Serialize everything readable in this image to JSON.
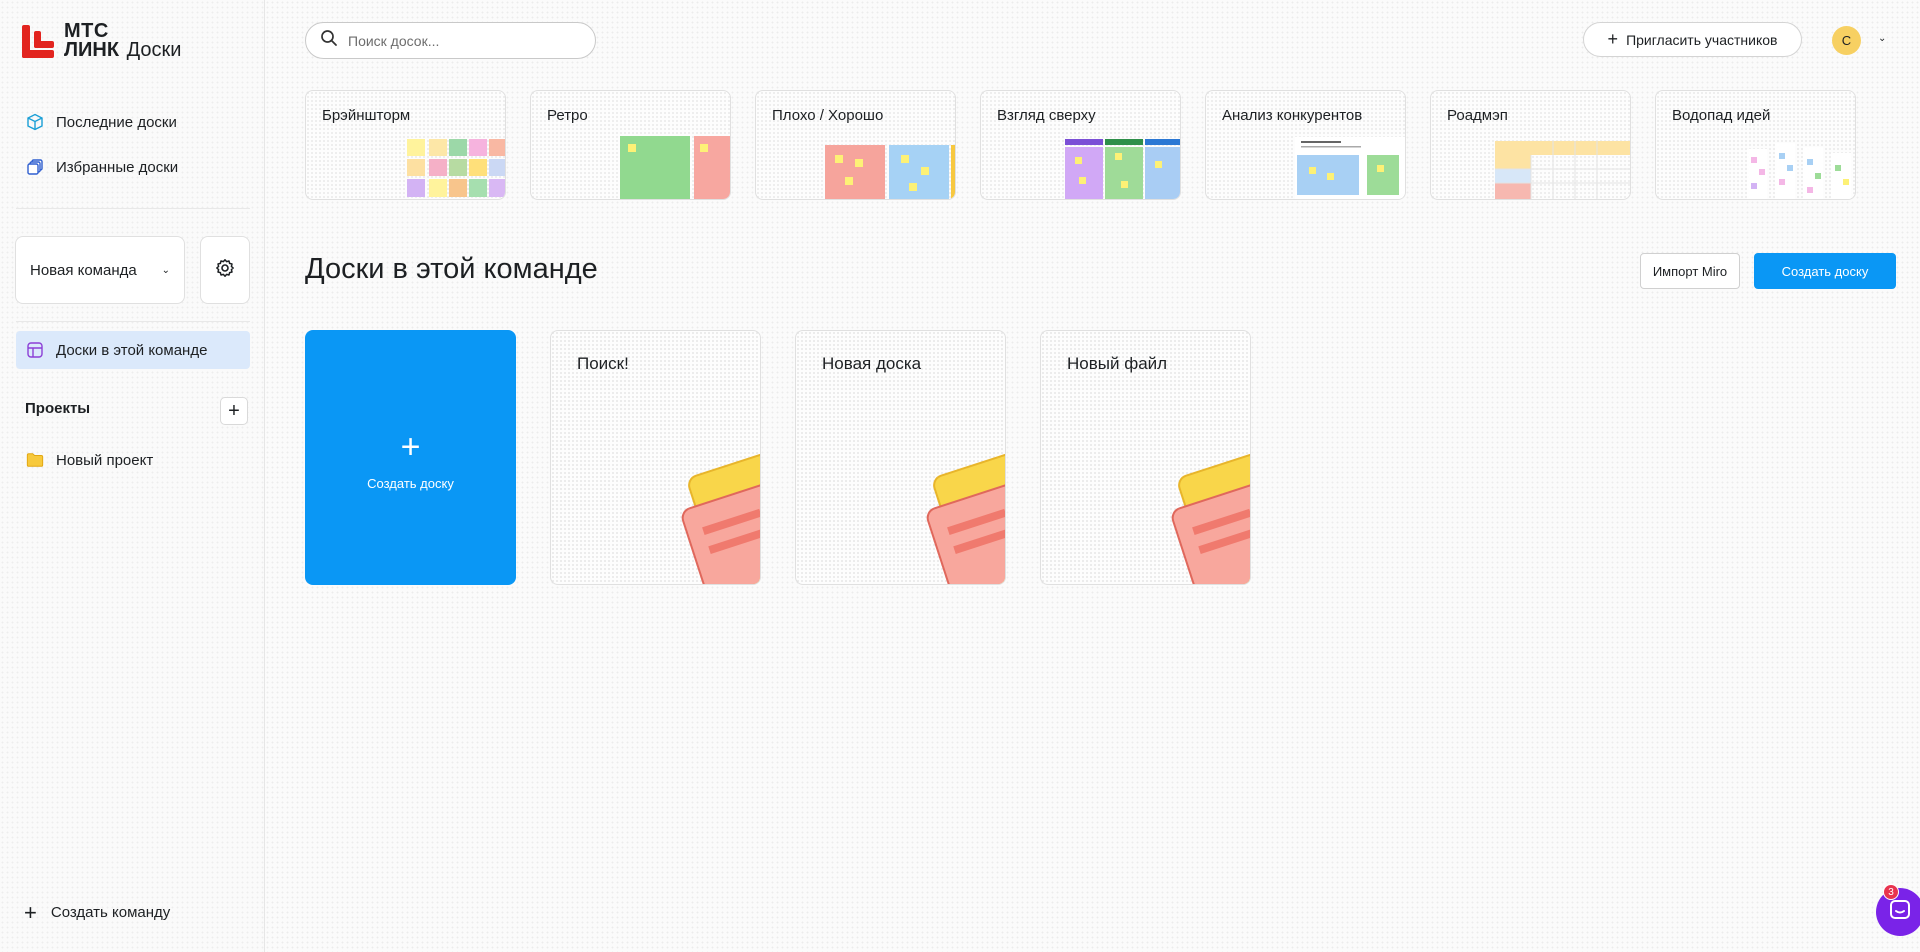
{
  "brand": {
    "line1": "МТС",
    "line2": "ЛИНК",
    "product": "Доски",
    "accent": "#e2241f"
  },
  "sidebar": {
    "nav": [
      {
        "label": "Последние доски",
        "icon": "cube-icon"
      },
      {
        "label": "Избранные доски",
        "icon": "stack-icon"
      }
    ],
    "team": {
      "name": "Новая команда"
    },
    "team_nav": {
      "label": "Доски в этой команде",
      "icon": "board-icon"
    },
    "projects": {
      "title": "Проекты",
      "items": [
        {
          "label": "Новый проект",
          "icon": "folder-icon"
        }
      ]
    },
    "create_team": "Создать команду"
  },
  "header": {
    "search_placeholder": "Поиск досок...",
    "invite_label": "Пригласить участников",
    "avatar_letter": "С"
  },
  "templates": [
    {
      "label": "Брэйншторм"
    },
    {
      "label": "Ретро"
    },
    {
      "label": "Плохо / Хорошо"
    },
    {
      "label": "Взгляд сверху"
    },
    {
      "label": "Анализ конкурентов"
    },
    {
      "label": "Роадмэп"
    },
    {
      "label": "Водопад идей"
    }
  ],
  "main": {
    "title": "Доски в этой команде",
    "import_label": "Импорт Miro",
    "create_label": "Создать доску",
    "create_card_label": "Создать доску",
    "boards": [
      {
        "title": "Поиск!"
      },
      {
        "title": "Новая доска"
      },
      {
        "title": "Новый файл"
      }
    ]
  },
  "chat": {
    "badge": "3"
  },
  "colors": {
    "primary": "#0a97f5",
    "chat": "#7a23e8",
    "badge": "#e8344f"
  }
}
